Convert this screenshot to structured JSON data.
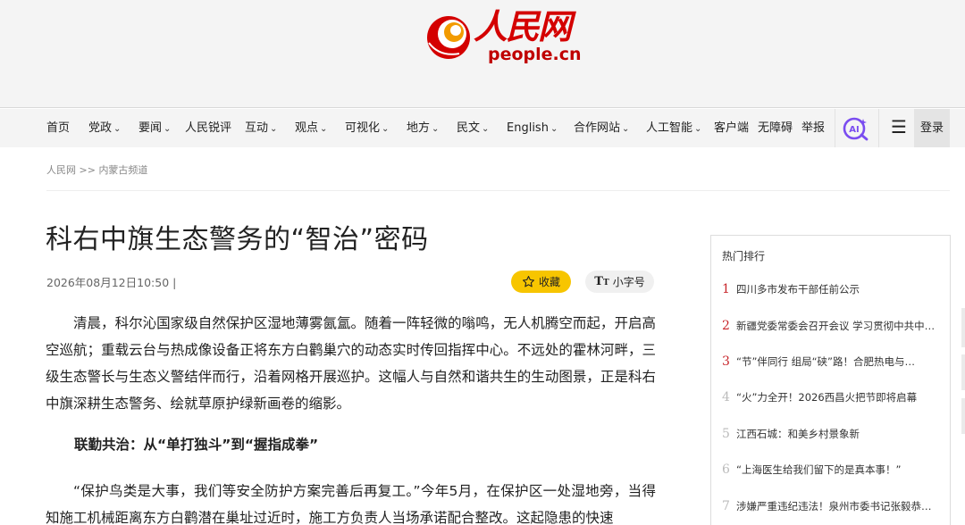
{
  "header": {
    "logo_cn": "人民网",
    "logo_en": "people.cn"
  },
  "nav": {
    "items": [
      {
        "label": "首页",
        "dropdown": false
      },
      {
        "label": "党政",
        "dropdown": true
      },
      {
        "label": "要闻",
        "dropdown": true
      },
      {
        "label": "人民锐评",
        "dropdown": false
      },
      {
        "label": "互动",
        "dropdown": true
      },
      {
        "label": "观点",
        "dropdown": true
      },
      {
        "label": "可视化",
        "dropdown": true
      },
      {
        "label": "地方",
        "dropdown": true
      },
      {
        "label": "民文",
        "dropdown": true
      },
      {
        "label": "English",
        "dropdown": true
      },
      {
        "label": "合作网站",
        "dropdown": true
      },
      {
        "label": "人工智能",
        "dropdown": true
      },
      {
        "label": "客户端",
        "dropdown": false
      },
      {
        "label": "无障碍",
        "dropdown": false
      },
      {
        "label": "举报",
        "dropdown": false
      }
    ],
    "chevron": "⌄",
    "ai_icon": "ai-search-icon",
    "menu_icon": "☰",
    "login": "登录"
  },
  "breadcrumb": {
    "home": "人民网",
    "sep": " >> ",
    "channel": "内蒙古频道"
  },
  "article": {
    "title": "科右中旗生态警务的“智治”密码",
    "meta": "2026年08月12日10:50 |",
    "favorite_label": "收藏",
    "font_size_label": "小字号",
    "paragraph1": "清晨，科尔沁国家级自然保护区湿地薄雾氤氲。随着一阵轻微的嗡鸣，无人机腾空而起，开启高空巡航；重载云台与热成像设备正将东方白鹳巢穴的动态实时传回指挥中心。不远处的霍林河畔，三级生态警长与生态义警结伴而行，沿着网格开展巡护。这幅人与自然和谐共生的生动图景，正是科右中旗深耕生态警务、绘就草原护绿新画卷的缩影。",
    "subheading": "联勤共治：从“单打独斗”到“握指成拳”",
    "paragraph2": "“保护鸟类是大事，我们等安全防护方案完善后再复工。”今年5月，在保护区一处湿地旁，当得知施工机械距离东方白鹳潜在巢址过近时，施工方负责人当场承诺配合整改。这起隐患的快速"
  },
  "sidebar": {
    "title": "热门排行",
    "items": [
      {
        "num": "1",
        "text": "四川多市发布干部任前公示",
        "highlight": true
      },
      {
        "num": "2",
        "text": "新疆党委常委会召开会议 学习贯彻中共中央政治局会议精神",
        "highlight": true
      },
      {
        "num": "3",
        "text": "“节”伴同行 组局“硖”路！合肥热电与…",
        "highlight": true
      },
      {
        "num": "4",
        "text": "“火”力全开！2026西昌火把节即将启幕",
        "highlight": false
      },
      {
        "num": "5",
        "text": "江西石城：和美乡村景象新",
        "highlight": false
      },
      {
        "num": "6",
        "text": "“上海医生给我们留下的是真本事！”",
        "highlight": false
      },
      {
        "num": "7",
        "text": "涉嫌严重违纪违法！泉州市委书记张毅恭任上被查",
        "highlight": false
      }
    ]
  },
  "colors": {
    "brand_red": "#d40000",
    "fav_yellow": "#f7c500",
    "rank_red": "#c8262b",
    "ai_purple": "#7a4cf0"
  }
}
